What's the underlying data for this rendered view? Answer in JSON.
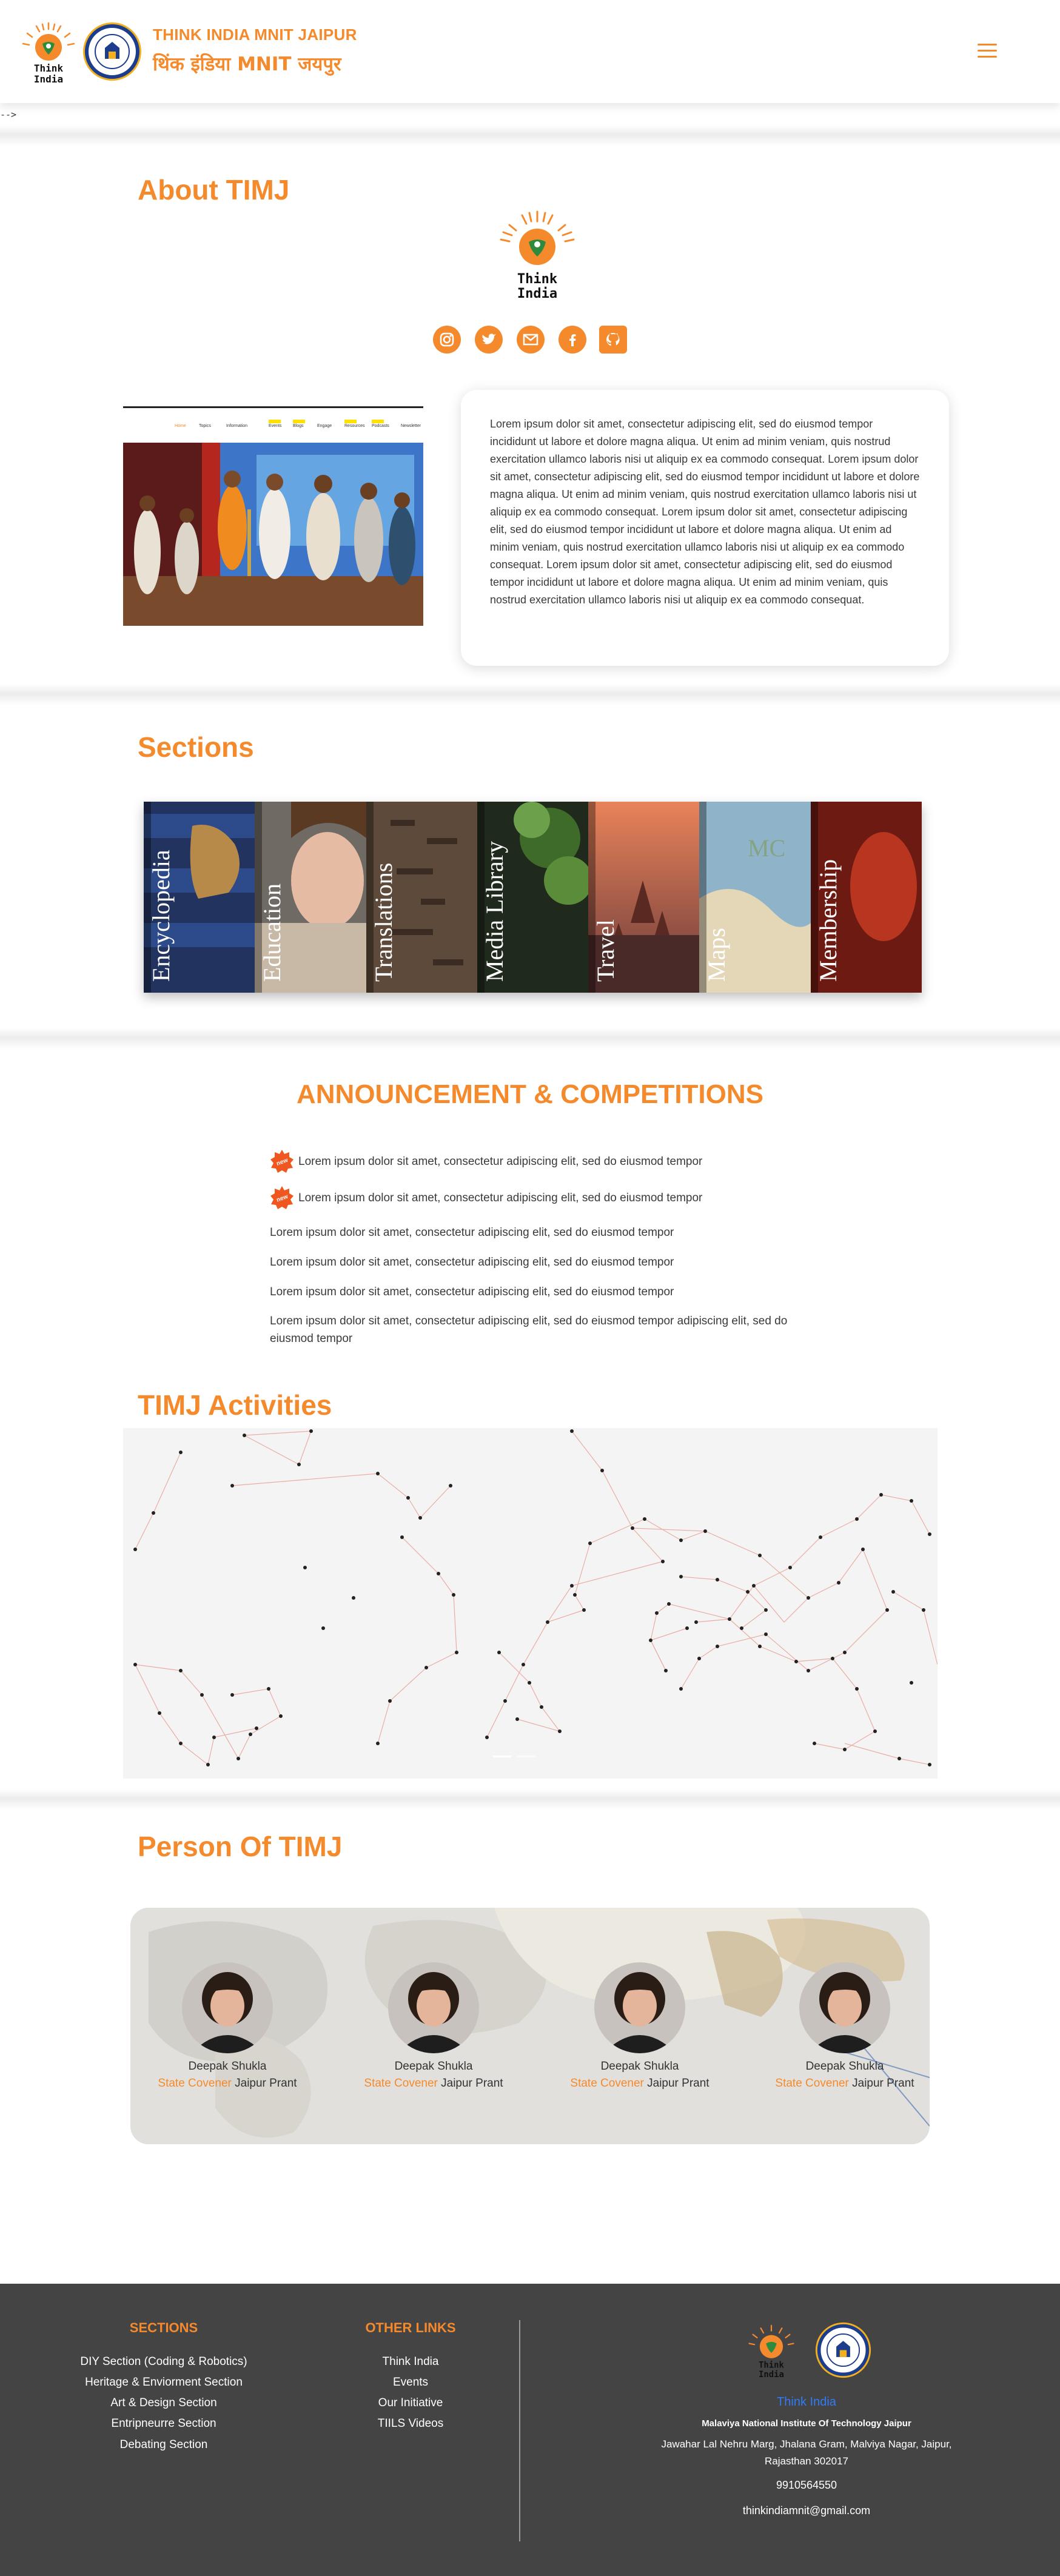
{
  "header": {
    "brand_en": "THINK INDIA MNIT JAIPUR",
    "brand_hi": "थिंक इंडिया MNIT जयपुर",
    "logo_text": "Think India",
    "stray_text": "-->"
  },
  "about": {
    "title": "About TIMJ",
    "logo_text_line1": "Think",
    "logo_text_line2": "India",
    "social": [
      "instagram-icon",
      "twitter-icon",
      "gmail-icon",
      "facebook-icon",
      "github-icon"
    ],
    "image_nav": [
      "Home",
      "Topics",
      "Information",
      "Events",
      "Blogs",
      "Engage",
      "Resources",
      "Podcasts",
      "Newsletter"
    ],
    "paragraph": "Lorem ipsum dolor sit amet, consectetur adipiscing elit, sed do eiusmod tempor incididunt ut labore et dolore magna aliqua. Ut enim ad minim veniam, quis nostrud exercitation ullamco laboris nisi ut aliquip ex ea commodo consequat. Lorem ipsum dolor sit amet, consectetur adipiscing elit, sed do eiusmod tempor incididunt ut labore et dolore magna aliqua. Ut enim ad minim veniam, quis nostrud exercitation ullamco laboris nisi ut aliquip ex ea commodo consequat. Lorem ipsum dolor sit amet, consectetur adipiscing elit, sed do eiusmod tempor incididunt ut labore et dolore magna aliqua. Ut enim ad minim veniam, quis nostrud exercitation ullamco laboris nisi ut aliquip ex ea commodo consequat. Lorem ipsum dolor sit amet, consectetur adipiscing elit, sed do eiusmod tempor incididunt ut labore et dolore magna aliqua. Ut enim ad minim veniam, quis nostrud exercitation ullamco laboris nisi ut aliquip ex ea commodo consequat."
  },
  "sections": {
    "title": "Sections",
    "books": [
      "Encyclopedia",
      "Education",
      "Translations",
      "Media Library",
      "Travel",
      "Maps",
      "Membership"
    ]
  },
  "announcements": {
    "title": "ANNOUNCEMENT & COMPETITIONS",
    "new_badge": "new",
    "items": [
      "Lorem ipsum dolor sit amet, consectetur adipiscing elit, sed do eiusmod tempor",
      "Lorem ipsum dolor sit amet, consectetur adipiscing elit, sed do eiusmod tempor",
      "Lorem ipsum dolor sit amet, consectetur adipiscing elit, sed do eiusmod tempor",
      "Lorem ipsum dolor sit amet, consectetur adipiscing elit, sed do eiusmod tempor",
      "Lorem ipsum dolor sit amet, consectetur adipiscing elit, sed do eiusmod tempor",
      "Lorem ipsum dolor sit amet, consectetur adipiscing elit, sed do eiusmod tempor adipiscing elit, sed do eiusmod tempor"
    ]
  },
  "activities": {
    "title": "TIMJ Activities"
  },
  "persons": {
    "title": "Person Of TIMJ",
    "people": [
      {
        "name": "Deepak Shukla",
        "role_highlight": "State Covener",
        "role_rest": " Jaipur Prant"
      },
      {
        "name": "Deepak Shukla",
        "role_highlight": "State Covener",
        "role_rest": " Jaipur Prant"
      },
      {
        "name": "Deepak Shukla",
        "role_highlight": "State Covener",
        "role_rest": " Jaipur Prant"
      },
      {
        "name": "Deepak Shukla",
        "role_highlight": "State Covener",
        "role_rest": " Jaipur Prant"
      }
    ]
  },
  "footer": {
    "sections_title": "SECTIONS",
    "sections": [
      "DIY Section (Coding & Robotics)",
      "Heritage & Enviorment Section",
      "Art & Design Section",
      "Entripneurre Section",
      "Debating Section"
    ],
    "links_title": "OTHER LINKS",
    "links": [
      "Think India",
      "Events",
      "Our Initiative",
      "TIILS Videos"
    ],
    "org_name": "Think India",
    "institute": "Malaviya National Institute Of Technology Jaipur",
    "address_line1": "Jawahar Lal Nehru Marg, Jhalana Gram, Malviya Nagar, Jaipur,",
    "address_line2": "Rajasthan 302017",
    "phone": "9910564550",
    "email": "thinkindiamnit@gmail.com"
  },
  "colors": {
    "accent": "#f58a2c",
    "footer_bg": "#454445",
    "link_blue": "#2f7cf6"
  }
}
